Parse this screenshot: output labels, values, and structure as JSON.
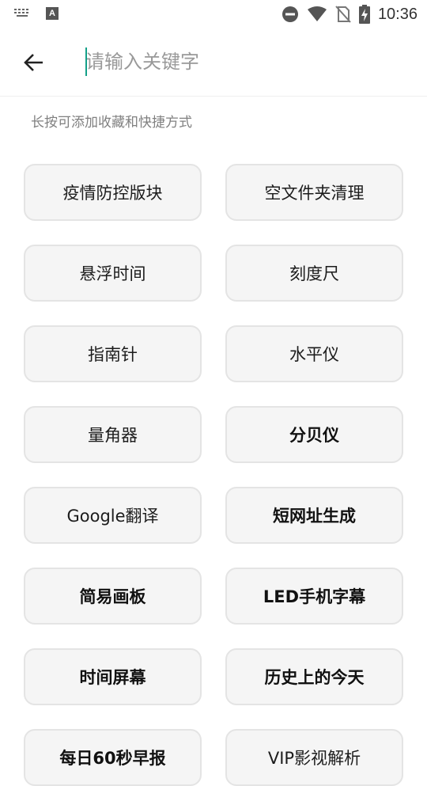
{
  "status_bar": {
    "time": "10:36",
    "left_icons": [
      "keyboard-icon",
      "a-notification-icon"
    ],
    "right_icons": [
      "do-not-disturb-icon",
      "wifi-icon",
      "no-sim-icon",
      "battery-charging-icon"
    ]
  },
  "search": {
    "placeholder": "请输入关键字",
    "value": "",
    "caret_color": "#13a088"
  },
  "hint": "长按可添加收藏和快捷方式",
  "tools": [
    {
      "label": "疫情防控版块",
      "bold": false
    },
    {
      "label": "空文件夹清理",
      "bold": false
    },
    {
      "label": "悬浮时间",
      "bold": false
    },
    {
      "label": "刻度尺",
      "bold": false
    },
    {
      "label": "指南针",
      "bold": false
    },
    {
      "label": "水平仪",
      "bold": false
    },
    {
      "label": "量角器",
      "bold": false
    },
    {
      "label": "分贝仪",
      "bold": true
    },
    {
      "label": "Google翻译",
      "bold": false
    },
    {
      "label": "短网址生成",
      "bold": true
    },
    {
      "label": "简易画板",
      "bold": true
    },
    {
      "label": "LED手机字幕",
      "bold": true
    },
    {
      "label": "时间屏幕",
      "bold": true
    },
    {
      "label": "历史上的今天",
      "bold": true
    },
    {
      "label": "每日60秒早报",
      "bold": true
    },
    {
      "label": "VIP影视解析",
      "bold": false
    }
  ]
}
